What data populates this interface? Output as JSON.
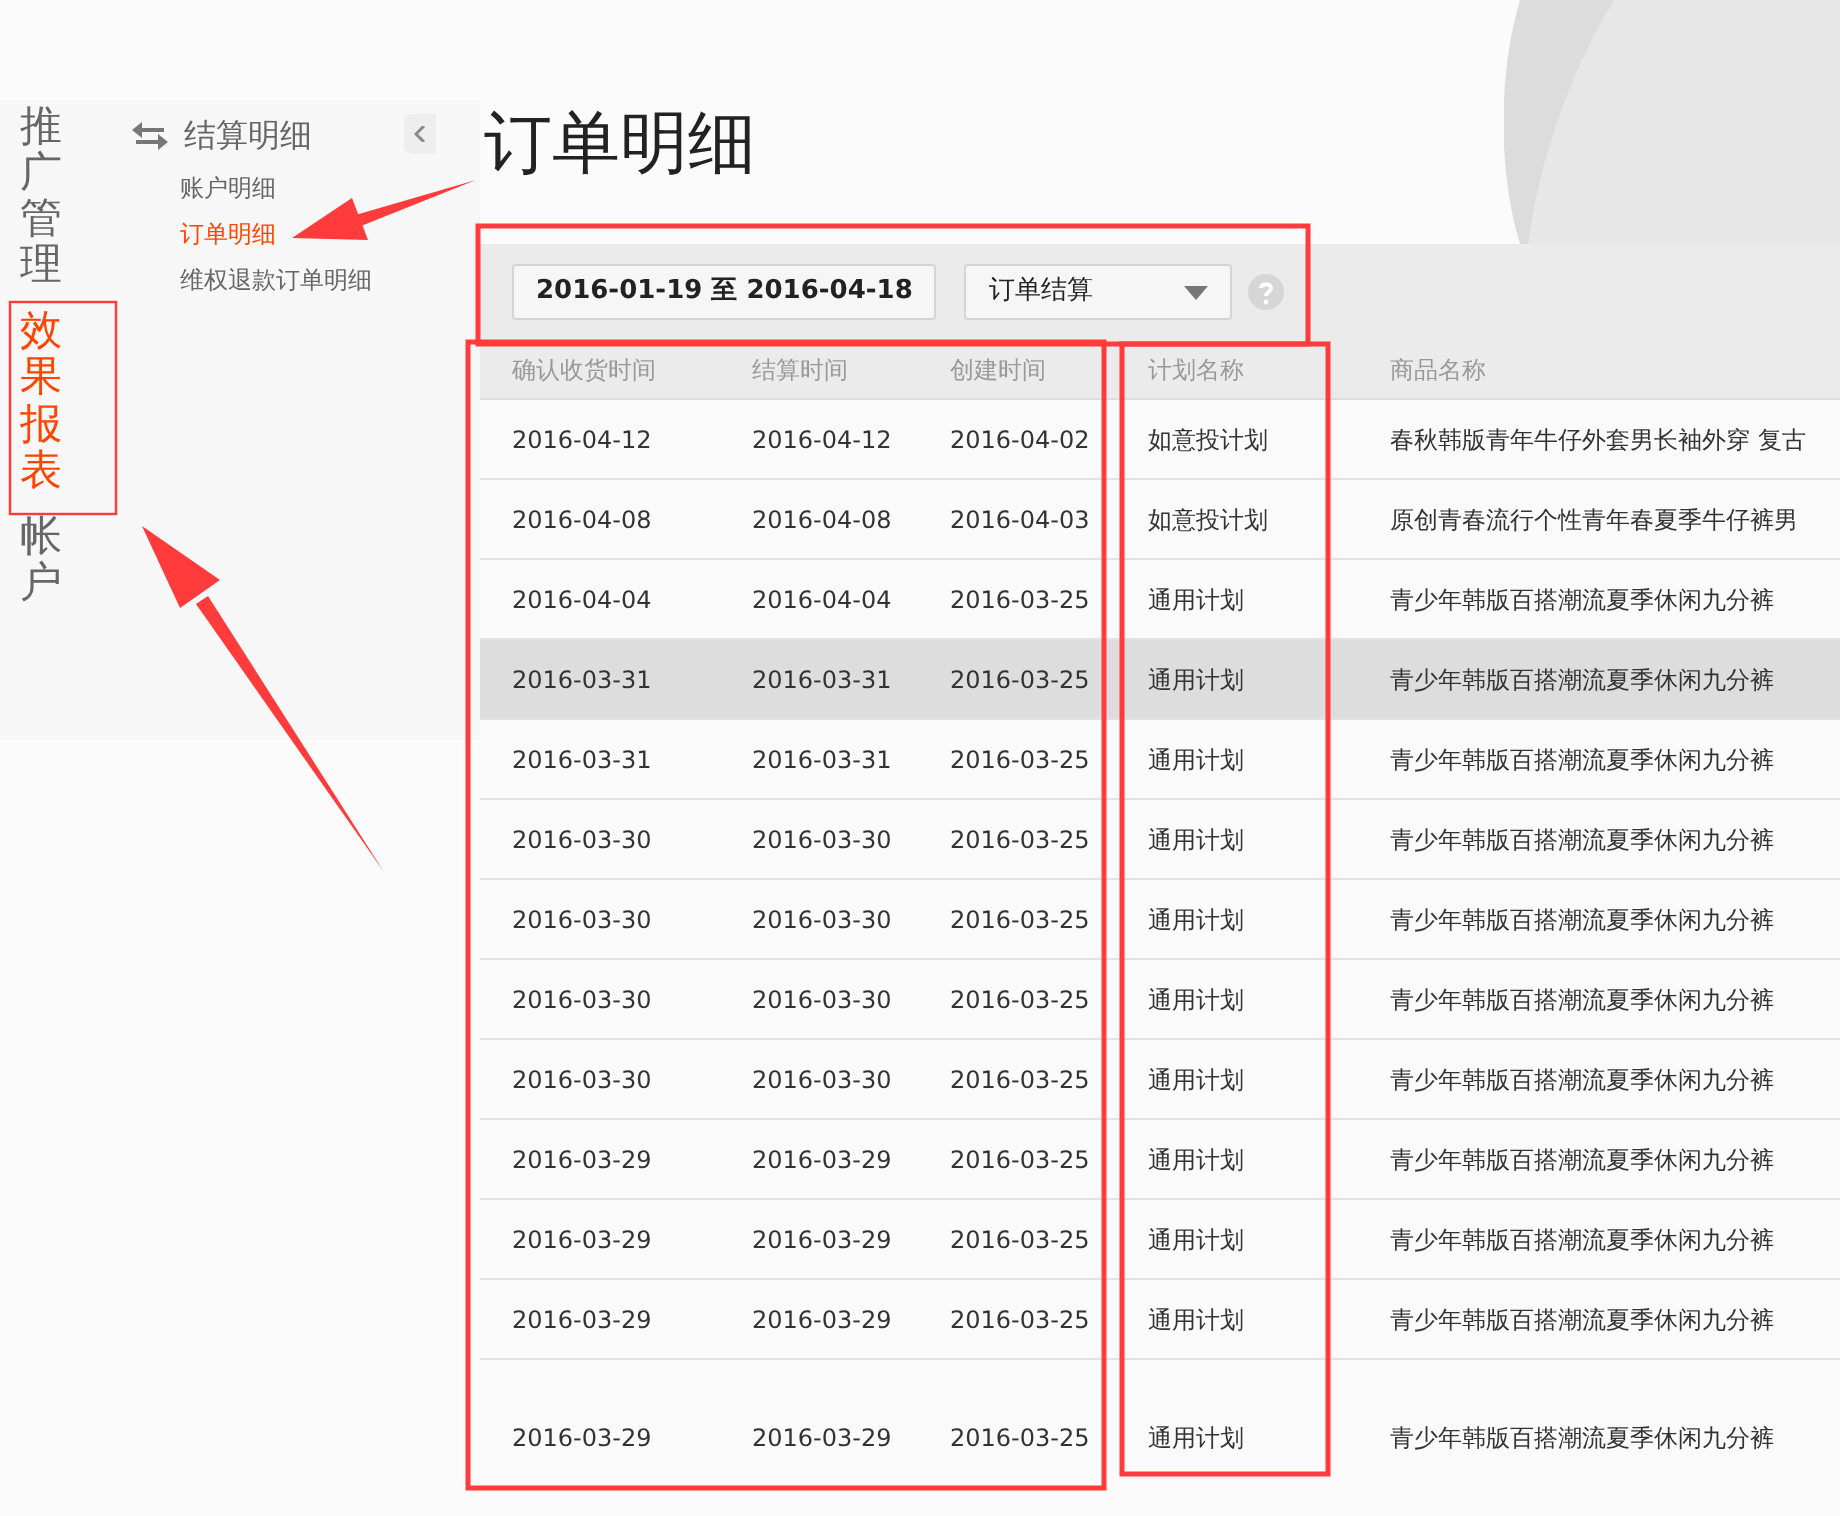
{
  "nav": [
    {
      "label": "推广管理",
      "selected": false
    },
    {
      "label": "效果报表",
      "selected": true
    },
    {
      "label": "帐户",
      "selected": false
    }
  ],
  "submenu": {
    "title": "结算明细",
    "items": [
      {
        "label": "账户明细",
        "selected": false
      },
      {
        "label": "订单明细",
        "selected": true
      },
      {
        "label": "维权退款订单明细",
        "selected": false
      }
    ]
  },
  "page_title": "订单明细",
  "filters": {
    "date_range": "2016-01-19 至 2016-04-18",
    "type_select": "订单结算"
  },
  "table": {
    "columns": [
      "确认收货时间",
      "结算时间",
      "创建时间",
      "计划名称",
      "商品名称"
    ],
    "rows": [
      {
        "selected": false,
        "cells": [
          "2016-04-12",
          "2016-04-12",
          "2016-04-02",
          "如意投计划",
          "春秋韩版青年牛仔外套男长袖外穿 复古"
        ]
      },
      {
        "selected": false,
        "cells": [
          "2016-04-08",
          "2016-04-08",
          "2016-04-03",
          "如意投计划",
          "原创青春流行个性青年春夏季牛仔裤男"
        ]
      },
      {
        "selected": false,
        "cells": [
          "2016-04-04",
          "2016-04-04",
          "2016-03-25",
          "通用计划",
          "青少年韩版百搭潮流夏季休闲九分裤"
        ]
      },
      {
        "selected": true,
        "cells": [
          "2016-03-31",
          "2016-03-31",
          "2016-03-25",
          "通用计划",
          "青少年韩版百搭潮流夏季休闲九分裤"
        ]
      },
      {
        "selected": false,
        "cells": [
          "2016-03-31",
          "2016-03-31",
          "2016-03-25",
          "通用计划",
          "青少年韩版百搭潮流夏季休闲九分裤"
        ]
      },
      {
        "selected": false,
        "cells": [
          "2016-03-30",
          "2016-03-30",
          "2016-03-25",
          "通用计划",
          "青少年韩版百搭潮流夏季休闲九分裤"
        ]
      },
      {
        "selected": false,
        "cells": [
          "2016-03-30",
          "2016-03-30",
          "2016-03-25",
          "通用计划",
          "青少年韩版百搭潮流夏季休闲九分裤"
        ]
      },
      {
        "selected": false,
        "cells": [
          "2016-03-30",
          "2016-03-30",
          "2016-03-25",
          "通用计划",
          "青少年韩版百搭潮流夏季休闲九分裤"
        ]
      },
      {
        "selected": false,
        "cells": [
          "2016-03-30",
          "2016-03-30",
          "2016-03-25",
          "通用计划",
          "青少年韩版百搭潮流夏季休闲九分裤"
        ]
      },
      {
        "selected": false,
        "cells": [
          "2016-03-29",
          "2016-03-29",
          "2016-03-25",
          "通用计划",
          "青少年韩版百搭潮流夏季休闲九分裤"
        ]
      },
      {
        "selected": false,
        "cells": [
          "2016-03-29",
          "2016-03-29",
          "2016-03-25",
          "通用计划",
          "青少年韩版百搭潮流夏季休闲九分裤"
        ]
      },
      {
        "selected": false,
        "cells": [
          "2016-03-29",
          "2016-03-29",
          "2016-03-25",
          "通用计划",
          "青少年韩版百搭潮流夏季休闲九分裤"
        ]
      },
      {
        "selected": false,
        "cells": [
          "2016-03-29",
          "2016-03-29",
          "2016-03-25",
          "通用计划",
          "青少年韩版百搭潮流夏季休闲九分裤"
        ]
      }
    ]
  }
}
